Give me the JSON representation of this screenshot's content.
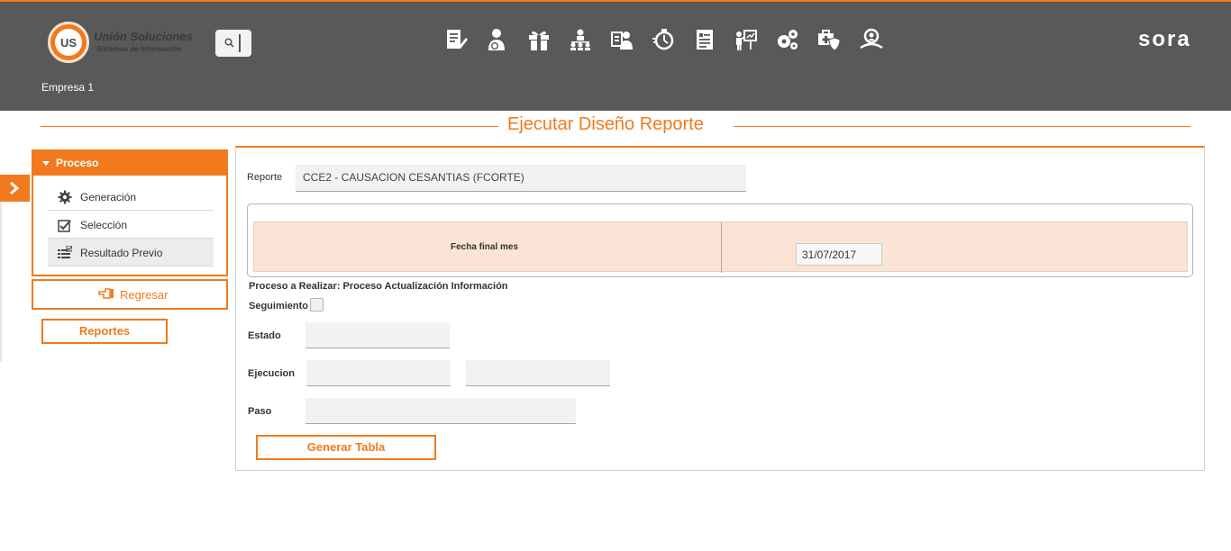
{
  "header": {
    "logo_line1": "Unión Soluciones",
    "logo_line2": "Sistemas de Información",
    "logo_mark": "US",
    "brand": "sora",
    "company": "Empresa 1",
    "nav_icons": [
      "report-edit-icon",
      "user-money-icon",
      "gift-icon",
      "org-chart-icon",
      "id-card-user-icon",
      "stopwatch-icon",
      "document-list-icon",
      "presenter-icon",
      "gears-icon",
      "medical-shield-icon",
      "user-search-icon"
    ]
  },
  "page": {
    "title": "Ejecutar Diseño Reporte"
  },
  "sidebar": {
    "section_title": "Proceso",
    "items": [
      {
        "label": "Generación",
        "icon": "gear-icon"
      },
      {
        "label": "Selección",
        "icon": "checkbox-icon"
      },
      {
        "label": "Resultado Previo",
        "icon": "checklist-icon"
      }
    ],
    "back_label": "Regresar",
    "reports_label": "Reportes"
  },
  "form": {
    "report_label": "Reporte",
    "report_value": "CCE2 - CAUSACION CESANTIAS (FCORTE)",
    "param_label": "Fecha final mes",
    "param_value": "31/07/2017",
    "process_text": "Proceso a Realizar: Proceso Actualización Información",
    "tracking_label": "Seguimiento",
    "tracking_checked": false,
    "status_label": "Estado",
    "status_value": "",
    "execution_label": "Ejecucion",
    "execution_value_1": "",
    "execution_value_2": "",
    "step_label": "Paso",
    "step_value": "",
    "generate_label": "Generar Tabla"
  },
  "colors": {
    "accent": "#f07a1d",
    "header_bg": "#595959",
    "param_row_bg": "#fbe4d5"
  }
}
